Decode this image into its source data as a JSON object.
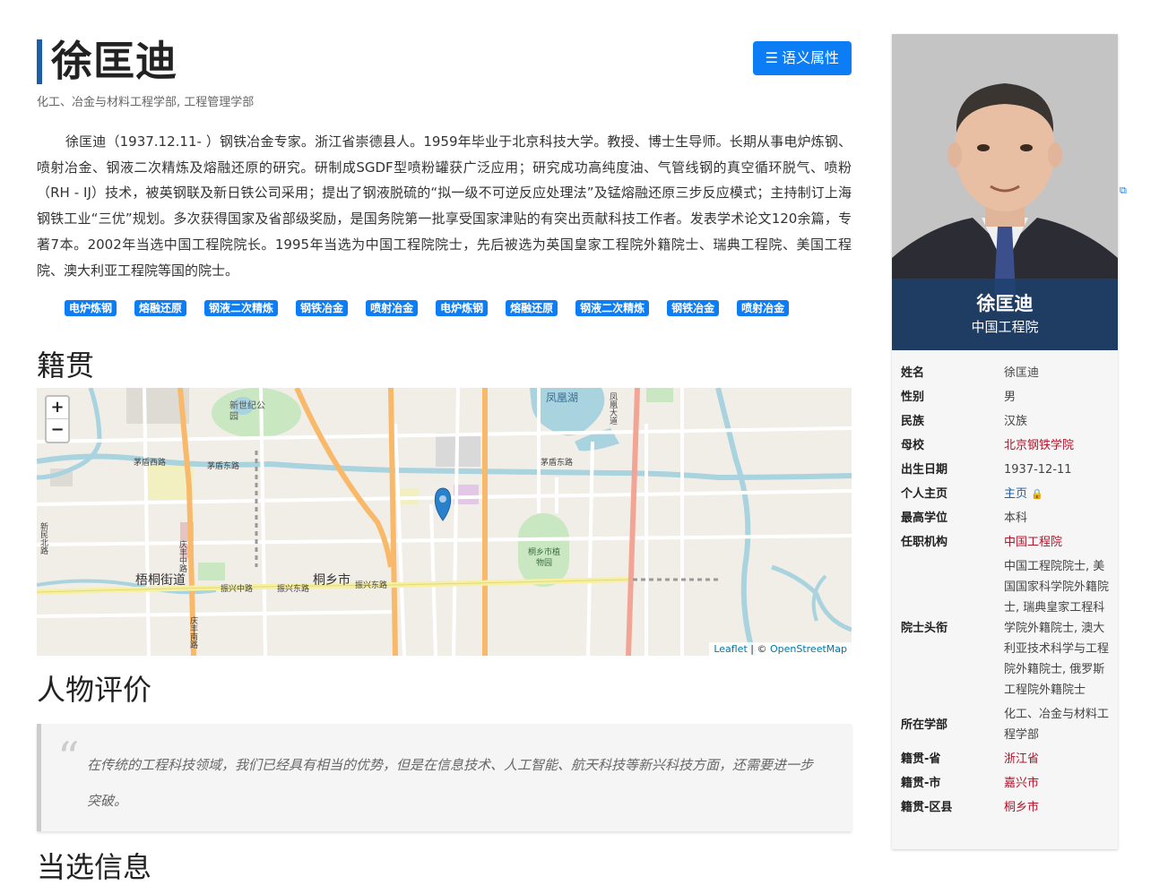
{
  "header": {
    "name": "徐匡迪",
    "semantic_button": "语义属性",
    "departments": "化工、冶金与材料工程学部, 工程管理学部"
  },
  "bio": "徐匡迪（1937.12.11- ）钢铁冶金专家。浙江省崇德县人。1959年毕业于北京科技大学。教授、博士生导师。长期从事电炉炼钢、喷射冶金、钢液二次精炼及熔融还原的研究。研制成SGDF型喷粉罐获广泛应用；研究成功高纯度油、气管线钢的真空循环脱气、喷粉（RH - IJ）技术，被英钢联及新日铁公司采用；提出了钢液脱硫的“拟一级不可逆反应处理法”及锰熔融还原三步反应模式；主持制订上海钢铁工业“三优”规划。多次获得国家及省部级奖励，是国务院第一批享受国家津贴的有突出贡献科技工作者。发表学术论文120余篇，专著7本。2002年当选中国工程院院长。1995年当选为中国工程院院士，先后被选为英国皇家工程院外籍院士、瑞典工程院、美国工程院、澳大利亚工程院等国的院士。",
  "tags": [
    "电炉炼钢",
    "熔融还原",
    "钢液二次精炼",
    "钢铁冶金",
    "喷射冶金",
    "电炉炼钢",
    "熔融还原",
    "钢液二次精炼",
    "钢铁冶金",
    "喷射冶金"
  ],
  "sections": {
    "jiguan": "籍贯",
    "pingjia": "人物评价",
    "dangxuan": "当选信息"
  },
  "map": {
    "zoom_in": "+",
    "zoom_out": "−",
    "attribution_leaflet": "Leaflet",
    "attribution_sep": " | © ",
    "attribution_osm": "OpenStreetMap",
    "labels": {
      "xinshiji": "新世纪公园",
      "fenghuanghu": "凤凰湖",
      "maodun_xi": "茅盾西路",
      "maodun_dong1": "茅盾东路",
      "maodun_dong2": "茅盾东路",
      "tongxiang": "桐乡市",
      "wutong": "梧桐街道",
      "zhenxing_zhong": "振兴中路",
      "zhenxing_dong1": "振兴东路",
      "zhenxing_dong2": "振兴东路",
      "qingfeng_n": "庆丰中路",
      "qingfeng_s": "庆丰南路",
      "zhiwuyuan": "桐乡市植物园",
      "fenghuang_dadao": "凤凰大道",
      "road_left": "新民北路"
    }
  },
  "quote": {
    "mark": "“",
    "text": "在传统的工程科技领域，我们已经具有相当的优势，但是在信息技术、人工智能、航天科技等新兴科技方面，还需要进一步突破。"
  },
  "side": {
    "photo_name": "徐匡迪",
    "photo_org": "中国工程院",
    "ext_icon": "external-link-icon",
    "info": [
      {
        "k": "姓名",
        "v": "徐匡迪",
        "style": ""
      },
      {
        "k": "性别",
        "v": "男",
        "style": ""
      },
      {
        "k": "民族",
        "v": "汉族",
        "style": ""
      },
      {
        "k": "母校",
        "v": "北京钢铁学院",
        "style": "link"
      },
      {
        "k": "出生日期",
        "v": "1937-12-11",
        "style": ""
      },
      {
        "k": "个人主页",
        "v": "主页",
        "style": "blue"
      },
      {
        "k": "最高学位",
        "v": "本科",
        "style": ""
      },
      {
        "k": "任职机构",
        "v": "中国工程院",
        "style": "link"
      },
      {
        "k": "院士头衔",
        "v": "中国工程院院士, 美国国家科学院外籍院士, 瑞典皇家工程科学院外籍院士, 澳大利亚技术科学与工程院外籍院士, 俄罗斯工程院外籍院士",
        "style": ""
      },
      {
        "k": "所在学部",
        "v": "化工、冶金与材料工程学部",
        "style": ""
      },
      {
        "k": "籍贯-省",
        "v": "浙江省",
        "style": "link"
      },
      {
        "k": "籍贯-市",
        "v": "嘉兴市",
        "style": "link"
      },
      {
        "k": "籍贯-区县",
        "v": "桐乡市",
        "style": "link"
      }
    ]
  },
  "colors": {
    "accent": "#0d7df5",
    "title_bar": "#1d5fa6",
    "link_red": "#b0142a",
    "caption_bg": "#1c3f6e"
  }
}
